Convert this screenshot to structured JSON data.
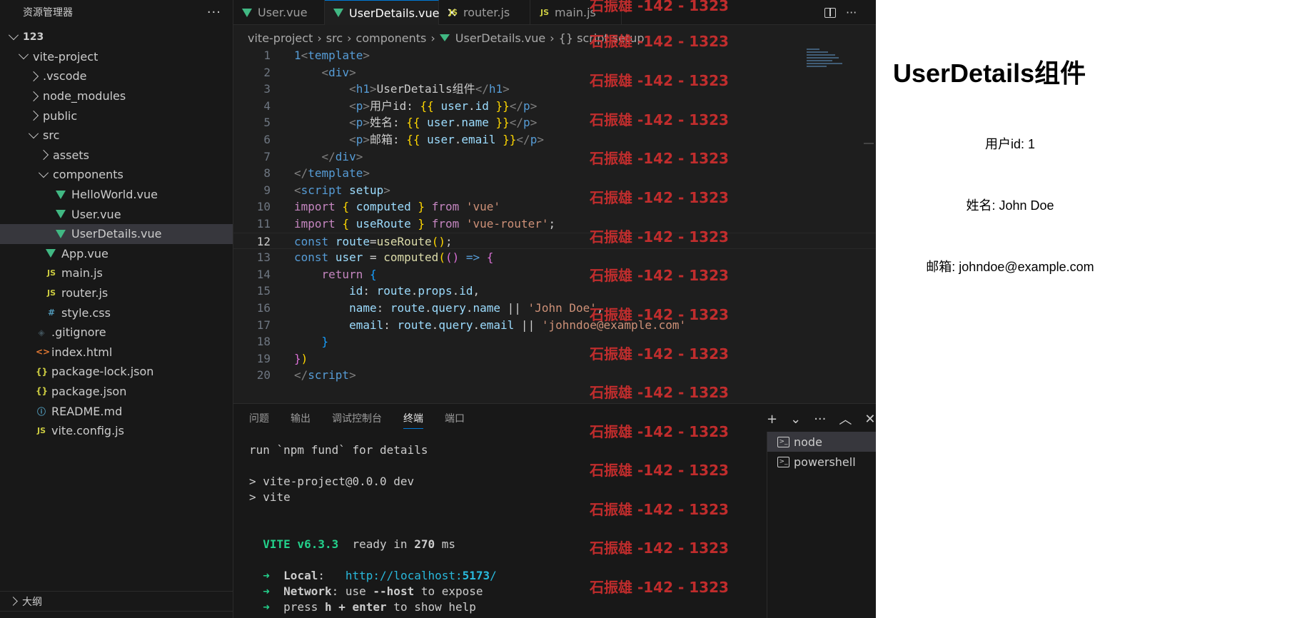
{
  "sidebar": {
    "title": "资源管理器",
    "more": "···",
    "items": [
      {
        "label": "123",
        "depth": 0,
        "type": "folder",
        "open": true,
        "root": true
      },
      {
        "label": "vite-project",
        "depth": 1,
        "type": "folder",
        "open": true
      },
      {
        "label": ".vscode",
        "depth": 2,
        "type": "folder",
        "open": false
      },
      {
        "label": "node_modules",
        "depth": 2,
        "type": "folder",
        "open": false
      },
      {
        "label": "public",
        "depth": 2,
        "type": "folder",
        "open": false
      },
      {
        "label": "src",
        "depth": 2,
        "type": "folder",
        "open": true
      },
      {
        "label": "assets",
        "depth": 3,
        "type": "folder",
        "open": false
      },
      {
        "label": "components",
        "depth": 3,
        "type": "folder",
        "open": true
      },
      {
        "label": "HelloWorld.vue",
        "depth": 4,
        "type": "vue"
      },
      {
        "label": "User.vue",
        "depth": 4,
        "type": "vue"
      },
      {
        "label": "UserDetails.vue",
        "depth": 4,
        "type": "vue",
        "selected": true
      },
      {
        "label": "App.vue",
        "depth": 3,
        "type": "vue"
      },
      {
        "label": "main.js",
        "depth": 3,
        "type": "js"
      },
      {
        "label": "router.js",
        "depth": 3,
        "type": "js"
      },
      {
        "label": "style.css",
        "depth": 3,
        "type": "css"
      },
      {
        "label": ".gitignore",
        "depth": 2,
        "type": "git"
      },
      {
        "label": "index.html",
        "depth": 2,
        "type": "html"
      },
      {
        "label": "package-lock.json",
        "depth": 2,
        "type": "json"
      },
      {
        "label": "package.json",
        "depth": 2,
        "type": "json"
      },
      {
        "label": "README.md",
        "depth": 2,
        "type": "info"
      },
      {
        "label": "vite.config.js",
        "depth": 2,
        "type": "js"
      }
    ],
    "outline": "大纲"
  },
  "icons": {
    "vue": "vue-icon",
    "js": "js-icon",
    "css": "css-icon",
    "json": "json-icon",
    "html": "html-icon",
    "git": "gitignore-icon",
    "info": "info-icon",
    "js_text": "JS",
    "css_text": "#",
    "json_text": "{}",
    "html_text": "<>",
    "git_text": "◈",
    "info_text": "ⓘ"
  },
  "tabs": [
    {
      "label": "User.vue",
      "type": "vue",
      "active": false
    },
    {
      "label": "UserDetails.vue",
      "type": "vue",
      "active": true
    },
    {
      "label": "router.js",
      "type": "js",
      "active": false
    },
    {
      "label": "main.js",
      "type": "js",
      "active": false
    }
  ],
  "tab_close": "✕",
  "breadcrumb": [
    "vite-project",
    "src",
    "components",
    "UserDetails.vue",
    "{} script setup"
  ],
  "breadcrumb_sep": "›",
  "code": {
    "current_line": 12,
    "lines": [
      [
        [
          "1",
          "t-const"
        ],
        [
          "<",
          "t-br"
        ],
        [
          "template",
          "t-tag"
        ],
        [
          ">",
          "t-br"
        ]
      ],
      [
        [
          "    ",
          ""
        ],
        [
          "<",
          "t-br"
        ],
        [
          "div",
          "t-tag"
        ],
        [
          ">",
          "t-br"
        ]
      ],
      [
        [
          "        ",
          ""
        ],
        [
          "<",
          "t-br"
        ],
        [
          "h1",
          "t-tag"
        ],
        [
          ">",
          "t-br"
        ],
        [
          "UserDetails组件",
          ""
        ],
        [
          "</",
          "t-br"
        ],
        [
          "h1",
          "t-tag"
        ],
        [
          ">",
          "t-br"
        ]
      ],
      [
        [
          "        ",
          ""
        ],
        [
          "<",
          "t-br"
        ],
        [
          "p",
          "t-tag"
        ],
        [
          ">",
          "t-br"
        ],
        [
          "用户id: ",
          ""
        ],
        [
          "{{",
          "t-sb"
        ],
        [
          " ",
          ""
        ],
        [
          "user",
          "t-var"
        ],
        [
          ".",
          ""
        ],
        [
          "id",
          "t-var"
        ],
        [
          " ",
          ""
        ],
        [
          "}}",
          "t-sb"
        ],
        [
          "</",
          "t-br"
        ],
        [
          "p",
          "t-tag"
        ],
        [
          ">",
          "t-br"
        ]
      ],
      [
        [
          "        ",
          ""
        ],
        [
          "<",
          "t-br"
        ],
        [
          "p",
          "t-tag"
        ],
        [
          ">",
          "t-br"
        ],
        [
          "姓名: ",
          ""
        ],
        [
          "{{",
          "t-sb"
        ],
        [
          " ",
          ""
        ],
        [
          "user",
          "t-var"
        ],
        [
          ".",
          ""
        ],
        [
          "name",
          "t-var"
        ],
        [
          " ",
          ""
        ],
        [
          "}}",
          "t-sb"
        ],
        [
          "</",
          "t-br"
        ],
        [
          "p",
          "t-tag"
        ],
        [
          ">",
          "t-br"
        ]
      ],
      [
        [
          "        ",
          ""
        ],
        [
          "<",
          "t-br"
        ],
        [
          "p",
          "t-tag"
        ],
        [
          ">",
          "t-br"
        ],
        [
          "邮箱: ",
          ""
        ],
        [
          "{{",
          "t-sb"
        ],
        [
          " ",
          ""
        ],
        [
          "user",
          "t-var"
        ],
        [
          ".",
          ""
        ],
        [
          "email",
          "t-var"
        ],
        [
          " ",
          ""
        ],
        [
          "}}",
          "t-sb"
        ],
        [
          "</",
          "t-br"
        ],
        [
          "p",
          "t-tag"
        ],
        [
          ">",
          "t-br"
        ]
      ],
      [
        [
          "    ",
          ""
        ],
        [
          "</",
          "t-br"
        ],
        [
          "div",
          "t-tag"
        ],
        [
          ">",
          "t-br"
        ]
      ],
      [
        [
          "</",
          "t-br"
        ],
        [
          "template",
          "t-tag"
        ],
        [
          ">",
          "t-br"
        ]
      ],
      [
        [
          "<",
          "t-br"
        ],
        [
          "script",
          "t-tag"
        ],
        [
          " ",
          ""
        ],
        [
          "setup",
          "t-var"
        ],
        [
          ">",
          "t-br"
        ]
      ],
      [
        [
          "import",
          "t-kw"
        ],
        [
          " ",
          ""
        ],
        [
          "{",
          "t-sb"
        ],
        [
          " ",
          ""
        ],
        [
          "computed",
          "t-var"
        ],
        [
          " ",
          ""
        ],
        [
          "}",
          "t-sb"
        ],
        [
          " ",
          ""
        ],
        [
          "from",
          "t-kw"
        ],
        [
          " ",
          ""
        ],
        [
          "'vue'",
          "t-str"
        ]
      ],
      [
        [
          "import",
          "t-kw"
        ],
        [
          " ",
          ""
        ],
        [
          "{",
          "t-sb"
        ],
        [
          " ",
          ""
        ],
        [
          "useRoute",
          "t-var"
        ],
        [
          " ",
          ""
        ],
        [
          "}",
          "t-sb"
        ],
        [
          " ",
          ""
        ],
        [
          "from",
          "t-kw"
        ],
        [
          " ",
          ""
        ],
        [
          "'vue-router'",
          "t-str"
        ],
        [
          ";",
          ""
        ]
      ],
      [
        [
          "const",
          "t-const"
        ],
        [
          " ",
          ""
        ],
        [
          "route",
          "t-var"
        ],
        [
          "=",
          ""
        ],
        [
          "useRoute",
          "t-fn"
        ],
        [
          "()",
          "t-sb"
        ],
        [
          ";",
          ""
        ]
      ],
      [
        [
          "const",
          "t-const"
        ],
        [
          " ",
          ""
        ],
        [
          "user",
          "t-var"
        ],
        [
          " = ",
          ""
        ],
        [
          "computed",
          "t-fn"
        ],
        [
          "(",
          "t-sb"
        ],
        [
          "()",
          "t-pb"
        ],
        [
          " ",
          ""
        ],
        [
          "=>",
          "t-const"
        ],
        [
          " ",
          ""
        ],
        [
          "{",
          "t-pb"
        ]
      ],
      [
        [
          "    ",
          ""
        ],
        [
          "return",
          "t-kw"
        ],
        [
          " ",
          ""
        ],
        [
          "{",
          "t-cb"
        ]
      ],
      [
        [
          "        ",
          ""
        ],
        [
          "id",
          "t-var"
        ],
        [
          ": ",
          ""
        ],
        [
          "route",
          "t-var"
        ],
        [
          ".",
          ""
        ],
        [
          "props",
          "t-var"
        ],
        [
          ".",
          ""
        ],
        [
          "id",
          "t-var"
        ],
        [
          ",",
          ""
        ]
      ],
      [
        [
          "        ",
          ""
        ],
        [
          "name",
          "t-var"
        ],
        [
          ": ",
          ""
        ],
        [
          "route",
          "t-var"
        ],
        [
          ".",
          ""
        ],
        [
          "query",
          "t-var"
        ],
        [
          ".",
          ""
        ],
        [
          "name",
          "t-var"
        ],
        [
          " || ",
          ""
        ],
        [
          "'John Doe'",
          "t-str"
        ],
        [
          ",",
          ""
        ]
      ],
      [
        [
          "        ",
          ""
        ],
        [
          "email",
          "t-var"
        ],
        [
          ": ",
          ""
        ],
        [
          "route",
          "t-var"
        ],
        [
          ".",
          ""
        ],
        [
          "query",
          "t-var"
        ],
        [
          ".",
          ""
        ],
        [
          "email",
          "t-var"
        ],
        [
          " || ",
          ""
        ],
        [
          "'johndoe@example.com'",
          "t-str"
        ]
      ],
      [
        [
          "    ",
          ""
        ],
        [
          "}",
          "t-cb"
        ]
      ],
      [
        [
          "}",
          "t-pb"
        ],
        [
          ")",
          "t-sb"
        ]
      ],
      [
        [
          "</",
          "t-br"
        ],
        [
          "script",
          "t-tag"
        ],
        [
          ">",
          "t-br"
        ]
      ]
    ]
  },
  "panel": {
    "tabs": [
      "问题",
      "输出",
      "调试控制台",
      "终端",
      "端口"
    ],
    "active_tab": "终端",
    "actions": [
      "+",
      "⌄",
      "···",
      "︿",
      "✕"
    ],
    "terminal_lines": [
      [
        [
          "run `npm fund` for details",
          ""
        ]
      ],
      [
        [
          "",
          ""
        ]
      ],
      [
        [
          "> vite-project@0.0.0 dev",
          ""
        ]
      ],
      [
        [
          "> vite",
          ""
        ]
      ],
      [
        [
          "",
          ""
        ]
      ],
      [
        [
          "",
          ""
        ]
      ],
      [
        [
          "  ",
          ""
        ],
        [
          "VITE",
          "g-green"
        ],
        [
          " v6.3.3",
          "g-green"
        ],
        [
          "  ready in ",
          ""
        ],
        [
          "270",
          "g-bold"
        ],
        [
          " ms",
          ""
        ]
      ],
      [
        [
          "",
          ""
        ]
      ],
      [
        [
          "  ➜  ",
          "g-green"
        ],
        [
          "Local",
          "g-bold"
        ],
        [
          ":   ",
          ""
        ],
        [
          "http://localhost:",
          "g-link"
        ],
        [
          "5173",
          "g-link g-bold"
        ],
        [
          "/",
          "g-link"
        ]
      ],
      [
        [
          "  ➜  ",
          "g-green"
        ],
        [
          "Network",
          "g-bold"
        ],
        [
          ": use ",
          ""
        ],
        [
          "--host",
          "g-bold"
        ],
        [
          " to expose",
          ""
        ]
      ],
      [
        [
          "  ➜  ",
          "g-green"
        ],
        [
          "press ",
          ""
        ],
        [
          "h + enter",
          "g-bold"
        ],
        [
          " to show help",
          ""
        ]
      ]
    ],
    "terminals": [
      {
        "label": "node",
        "active": true
      },
      {
        "label": "powershell",
        "active": false
      }
    ]
  },
  "preview": {
    "title": "UserDetails组件",
    "user_id": "用户id: 1",
    "name": "姓名: John Doe",
    "email": "邮箱: johndoe@example.com"
  },
  "watermark": "石振雄 -142 - 1323"
}
